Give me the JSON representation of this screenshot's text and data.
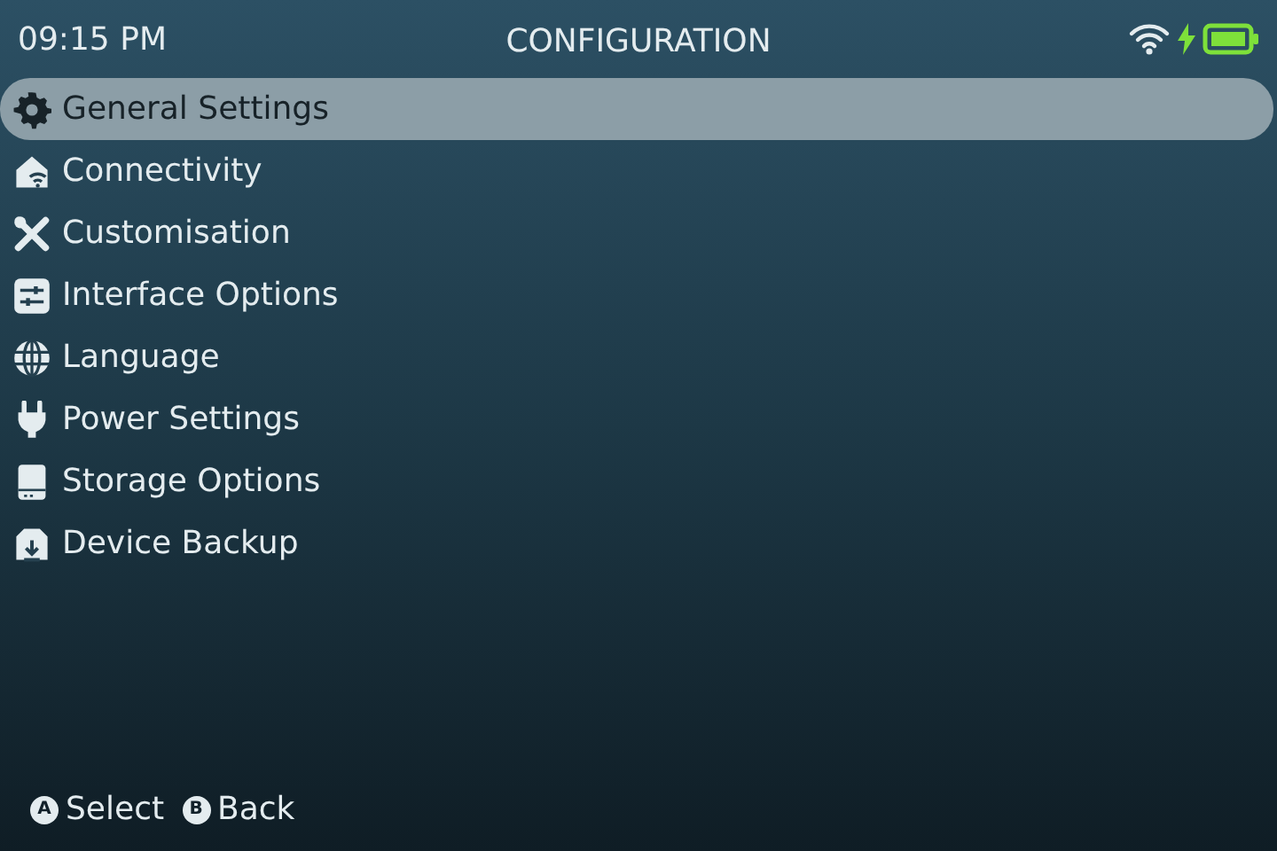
{
  "status_bar": {
    "time": "09:15 PM",
    "title": "CONFIGURATION",
    "charging": true
  },
  "menu": [
    {
      "label": "General Settings",
      "selected": true
    },
    {
      "label": "Connectivity",
      "selected": false
    },
    {
      "label": "Customisation",
      "selected": false
    },
    {
      "label": "Interface Options",
      "selected": false
    },
    {
      "label": "Language",
      "selected": false
    },
    {
      "label": "Power Settings",
      "selected": false
    },
    {
      "label": "Storage Options",
      "selected": false
    },
    {
      "label": "Device Backup",
      "selected": false
    }
  ],
  "hints": [
    {
      "button": "A",
      "label": "Select"
    },
    {
      "button": "B",
      "label": "Back"
    }
  ]
}
